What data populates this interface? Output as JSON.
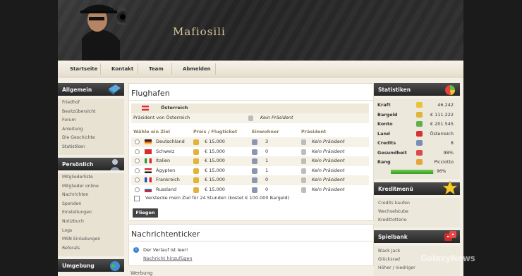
{
  "banner": {
    "logo": "Mafiosili"
  },
  "nav": [
    "Startseite",
    "Kontakt",
    "Team",
    "Abmelden"
  ],
  "left": {
    "allgemein": {
      "title": "Allgemein",
      "items": [
        "Friedhof",
        "Besitzübersicht",
        "Forum",
        "Anleitung",
        "Die Geschichte",
        "Statistiken"
      ]
    },
    "persoenlich": {
      "title": "Persönlich",
      "items": [
        "Mitgliederliste",
        "Mitglieder online",
        "Nachrichten",
        "Spenden",
        "Einstellungen",
        "Notizbuch",
        "Logs",
        "MSN Einladungen",
        "Referals"
      ]
    },
    "umgebung": {
      "title": "Umgebung"
    }
  },
  "flughafen": {
    "title": "Flughafen",
    "country": "Österreich",
    "president_label": "Präsident von Österreich",
    "president_value": "Kein Präsident",
    "headers": [
      "Wähle ein Ziel",
      "Preis / Flugticket",
      "Einwohner",
      "Präsident"
    ],
    "rows": [
      {
        "name": "Deutschland",
        "price": "€ 15.000",
        "pop": "3",
        "pres": "Kein Präsident"
      },
      {
        "name": "Schweiz",
        "price": "€ 15.000",
        "pop": "0",
        "pres": "Kein Präsident"
      },
      {
        "name": "Italien",
        "price": "€ 15.000",
        "pop": "1",
        "pres": "Kein Präsident"
      },
      {
        "name": "Ägypten",
        "price": "€ 15.000",
        "pop": "1",
        "pres": "Kein Präsident"
      },
      {
        "name": "Frankreich",
        "price": "€ 15.000",
        "pop": "0",
        "pres": "Kein Präsident"
      },
      {
        "name": "Russland",
        "price": "€ 15.000",
        "pop": "0",
        "pres": "Kein Präsident"
      }
    ],
    "hide_label": "Verstecke mein Ziel für 24 Stunden (kostet € 100.000 Bargeld)",
    "button": "Fliegen"
  },
  "ticker": {
    "title": "Nachrichtenticker",
    "empty": "Der Verlauf ist leer!",
    "link": "Nachricht hinzufügen"
  },
  "werbung": {
    "title": "Werbung"
  },
  "stats": {
    "title": "Statistiken",
    "rows": [
      {
        "label": "Kraft",
        "value": "46.242",
        "color": "#e8c23a"
      },
      {
        "label": "Bargeld",
        "value": "€ 111.222",
        "color": "#e0b339"
      },
      {
        "label": "Konto",
        "value": "€ 201.545",
        "color": "#5fb04a"
      },
      {
        "label": "Land",
        "value": "Österreich",
        "color": "#d93030"
      },
      {
        "label": "Credits",
        "value": "8",
        "color": "#7a8db3"
      },
      {
        "label": "Gesundheit",
        "value": "98%",
        "color": "#d94a4a"
      },
      {
        "label": "Rang",
        "value": "Picciotto",
        "color": "#e8a33a"
      }
    ],
    "progress_percent": 96,
    "progress_label": "96%"
  },
  "kredit": {
    "title": "Kreditmenü",
    "items": [
      "Credits kaufen",
      "Wechselstube",
      "Kreditlotterie"
    ]
  },
  "spielbank": {
    "title": "Spielbank",
    "items": [
      "Black Jack",
      "Glücksrad",
      "Höher / niedriger"
    ]
  },
  "watermark": "GalaxyNews"
}
